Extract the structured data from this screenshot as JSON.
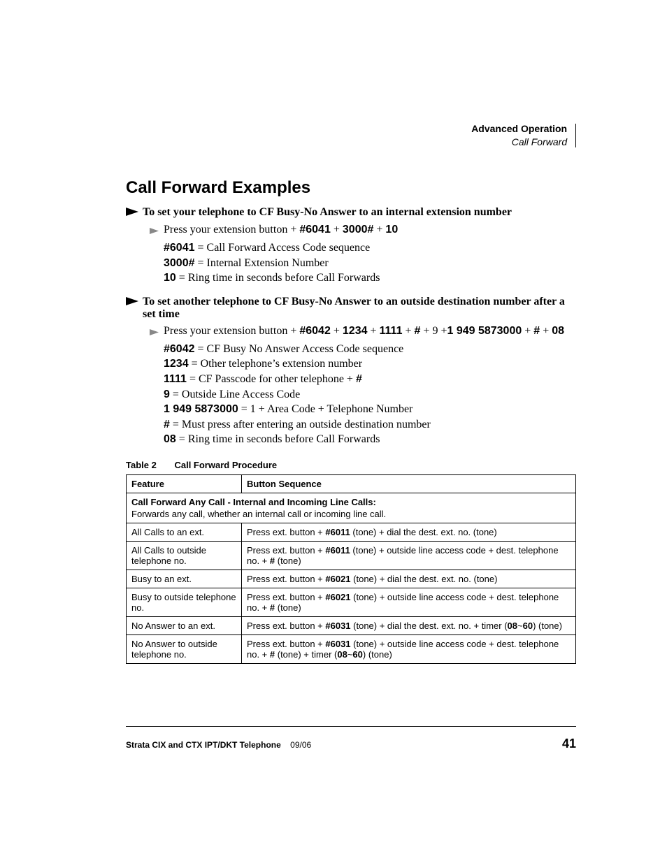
{
  "running_head": {
    "chapter": "Advanced Operation",
    "section": "Call Forward"
  },
  "title": "Call Forward Examples",
  "proc1": {
    "heading": "To set your telephone to CF Busy-No Answer to an internal extension number",
    "step_prefix": "Press your extension button",
    "seq": [
      "#6041",
      "3000#",
      "10"
    ],
    "defs": [
      {
        "code": "#6041",
        "text": " = Call Forward Access Code sequence"
      },
      {
        "code": "3000#",
        "text": " = Internal Extension Number"
      },
      {
        "code": "10",
        "text": " = Ring time in seconds before Call Forwards"
      }
    ]
  },
  "proc2": {
    "heading": "To set another telephone to CF Busy-No Answer to an outside destination number after a set time",
    "step_prefix": "Press your extension button",
    "seq_a": [
      "#6042",
      "1234",
      "1111",
      "#"
    ],
    "seq_b_plain": "9",
    "seq_c": "1 949 5873000",
    "seq_d": [
      "#",
      "08"
    ],
    "defs": [
      {
        "code": "#6042",
        "text": " = CF Busy No Answer Access Code sequence"
      },
      {
        "code": "1234",
        "text": " = Other telephone’s extension number"
      },
      {
        "code": "1111",
        "text": " = CF Passcode for other telephone + ",
        "code2": "#"
      },
      {
        "code": "9",
        "text": " = Outside Line Access Code"
      },
      {
        "code": "1 949 5873000",
        "text": " = 1 + Area Code + Telephone Number"
      },
      {
        "code": "#",
        "text": " = Must press after entering an outside destination number"
      },
      {
        "code": "08",
        "text": " = Ring time in seconds before Call Forwards"
      }
    ]
  },
  "table": {
    "caption_num": "Table 2",
    "caption_title": "Call Forward Procedure",
    "col1": "Feature",
    "col2": "Button Sequence",
    "group": {
      "title": "Call Forward Any Call - Internal and Incoming Line Calls:",
      "desc": "Forwards any call, whether an internal call or incoming line call."
    },
    "rows": [
      {
        "feature": "All Calls to an ext.",
        "seq": [
          {
            "t": "Press ext. button + "
          },
          {
            "b": "#6011"
          },
          {
            "t": " (tone) + dial the dest. ext. no. (tone)"
          }
        ]
      },
      {
        "feature": "All Calls to outside telephone no.",
        "seq": [
          {
            "t": "Press ext. button + "
          },
          {
            "b": "#6011"
          },
          {
            "t": " (tone) + outside line access code + dest. telephone no. + "
          },
          {
            "b": "#"
          },
          {
            "t": " (tone)"
          }
        ]
      },
      {
        "feature": "Busy to an ext.",
        "seq": [
          {
            "t": "Press ext. button + "
          },
          {
            "b": "#6021"
          },
          {
            "t": " (tone) + dial the dest. ext. no. (tone)"
          }
        ]
      },
      {
        "feature": "Busy to outside telephone no.",
        "seq": [
          {
            "t": "Press ext. button + "
          },
          {
            "b": "#6021"
          },
          {
            "t": " (tone) + outside line access code + dest. telephone no. + "
          },
          {
            "b": "#"
          },
          {
            "t": " (tone)"
          }
        ]
      },
      {
        "feature": "No Answer to an ext.",
        "seq": [
          {
            "t": "Press ext. button + "
          },
          {
            "b": "#6031"
          },
          {
            "t": " (tone) + dial the dest. ext. no. + timer ("
          },
          {
            "b": "08"
          },
          {
            "t": "~"
          },
          {
            "b": "60"
          },
          {
            "t": ") (tone)"
          }
        ]
      },
      {
        "feature": "No Answer to outside telephone no.",
        "seq": [
          {
            "t": "Press ext. button + "
          },
          {
            "b": "#6031"
          },
          {
            "t": " (tone) + outside line access code + dest. telephone no. + "
          },
          {
            "b": "#"
          },
          {
            "t": " (tone) + timer ("
          },
          {
            "b": "08"
          },
          {
            "t": "~"
          },
          {
            "b": "60"
          },
          {
            "t": ") (tone)"
          }
        ]
      }
    ]
  },
  "footer": {
    "product": "Strata CIX and CTX IPT/DKT Telephone",
    "date": "09/06",
    "page": "41"
  }
}
